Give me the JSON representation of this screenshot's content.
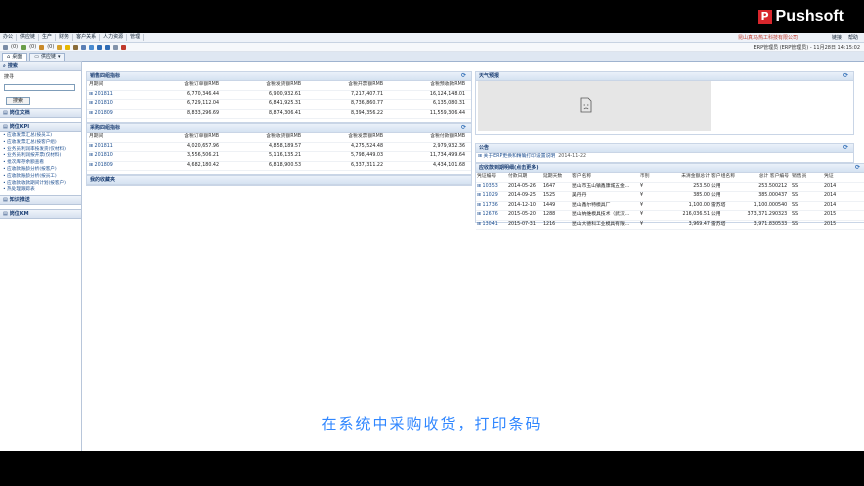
{
  "brand": {
    "name": "Pushsoft",
    "mark": "P"
  },
  "menu": [
    "办公",
    "供应链",
    "生产",
    "财务",
    "客户关系",
    "人力资源",
    "管理"
  ],
  "company": "昆山真马热工科技有限公司",
  "right_links": [
    "链接",
    "帮助"
  ],
  "toolbar": {
    "count1": "(0)",
    "count2": "(0)",
    "count3": "(0)"
  },
  "user_info": "ERP管理员 (ERP管理员) - 11月28日 14:15:02",
  "tabs": [
    "桌面",
    "供应链"
  ],
  "sidebar": {
    "search_head": "搜索",
    "search_label": "搜寻",
    "search_button": "搜索",
    "docs_head": "岗位文档",
    "kpi_head": "岗位KPI",
    "kpi_links": [
      "应收发票汇总(按员工)",
      "应收发票汇总(按客户组)",
      "业务员利润率按发货(仅材料)",
      "业务员利润按开票(仅材料)",
      "批次库存余额查看",
      "应收款账龄分析(按客户)",
      "应收款账龄分析(按员工)",
      "应收款收款期间计划(按客户)",
      "热处理跟踪表"
    ],
    "knowledge_head": "知识推送",
    "km_head": "岗位KM"
  },
  "sales": {
    "title": "销售四组指标",
    "headers": [
      "月期间",
      "含税订单额RMB",
      "含税发货额RMB",
      "含税开票额RMB",
      "含税预收款RMB"
    ],
    "rows": [
      [
        "201811",
        "6,770,346.44",
        "6,900,932.61",
        "7,217,407.71",
        "16,124,148.01"
      ],
      [
        "201810",
        "6,729,112.04",
        "6,841,925.31",
        "8,736,860.77",
        "6,135,080.31"
      ],
      [
        "201809",
        "8,833,296.69",
        "8,874,306.41",
        "8,394,356.22",
        "11,559,306.44"
      ]
    ]
  },
  "purchase": {
    "title": "采购四组指标",
    "headers": [
      "月期间",
      "含税订单额RMB",
      "含税收货额RMB",
      "含税发票额RMB",
      "含税付款额RMB"
    ],
    "rows": [
      [
        "201811",
        "4,020,657.96",
        "4,858,189.57",
        "4,275,524.48",
        "2,979,932.36"
      ],
      [
        "201810",
        "3,556,506.21",
        "5,116,135.21",
        "5,798,449.03",
        "11,734,499.64"
      ],
      [
        "201809",
        "4,682,180.42",
        "6,818,900.53",
        "6,337,311.22",
        "4,434,101.68"
      ]
    ]
  },
  "receivable_week": {
    "title": "我的收藏夹"
  },
  "weather": {
    "title": "天气预报"
  },
  "notice": {
    "title": "公告",
    "item": "关于ERP更换和精确打印设置说明",
    "date": "2014-11-22"
  },
  "due": {
    "title": "应收款到期明细(点击更多)",
    "headers": [
      "凭证编号",
      "付款日期",
      "延期天数",
      "客户名称",
      "币别",
      "未清金额总计",
      "客户组名称",
      "总计 客户编号",
      "销售员",
      "凭证"
    ],
    "rows": [
      [
        "10353",
        "2014-05-26",
        "1647",
        "昆山市玉山镇鑫康城五金...",
        "¥",
        "253.50",
        "公用",
        "253.50",
        "0212",
        "SS",
        "2014"
      ],
      [
        "11029",
        "2014-09-25",
        "1525",
        "吴丹丹",
        "¥",
        "385.00",
        "公用",
        "385.00",
        "0437",
        "SS",
        "2014"
      ],
      [
        "11736",
        "2014-12-10",
        "1449",
        "昆山鑫尔特模具厂",
        "¥",
        "1,100.00",
        "雷苏塔",
        "1,100.00",
        "0540",
        "SS",
        "2014"
      ],
      [
        "12676",
        "2015-05-20",
        "1288",
        "昆山纳维模具技术（武汉...",
        "¥",
        "216,036.51",
        "公用",
        "373,371.29",
        "0323",
        "SS",
        "2015"
      ],
      [
        "13041",
        "2015-07-31",
        "1216",
        "昆山大德科工业模具有限...",
        "¥",
        "3,969.47",
        "雷苏塔",
        "3,971.83",
        "0533",
        "SS",
        "2015"
      ]
    ]
  },
  "caption": "在系统中采购收货，打印条码"
}
